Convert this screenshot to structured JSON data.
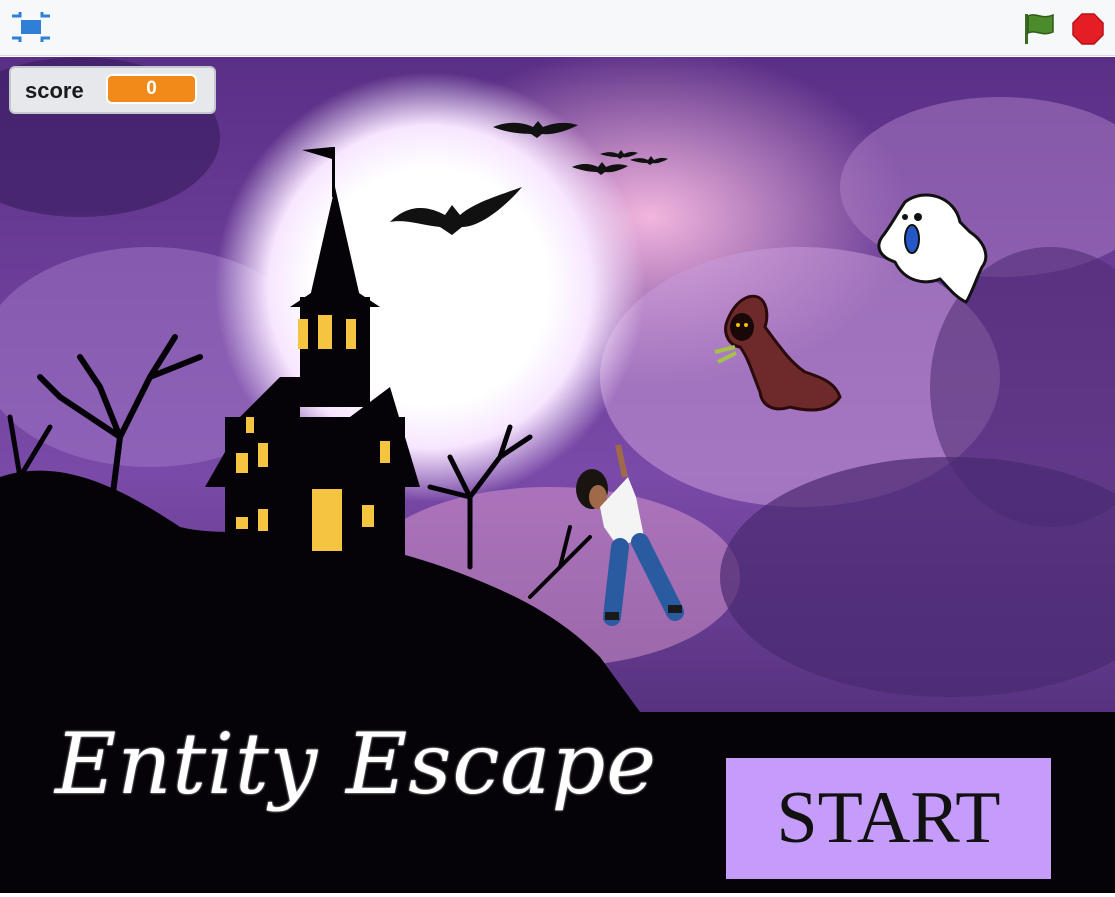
{
  "toolbar": {
    "fullscreen_icon": "fullscreen-icon",
    "flag_icon": "green-flag-icon",
    "stop_icon": "stop-icon"
  },
  "monitor": {
    "label": "score",
    "value": "0"
  },
  "game": {
    "title": "Entity Escape",
    "start_label": "START"
  },
  "colors": {
    "monitor_value_bg": "#f28a1a",
    "start_button_bg": "#c69cfb",
    "sky": "#6b3d9a",
    "moon": "#ffffff",
    "window_light": "#f5c542",
    "flag_green": "#4c8b2b",
    "stop_red": "#e51e26",
    "fullscreen_blue": "#2f7fd6"
  }
}
